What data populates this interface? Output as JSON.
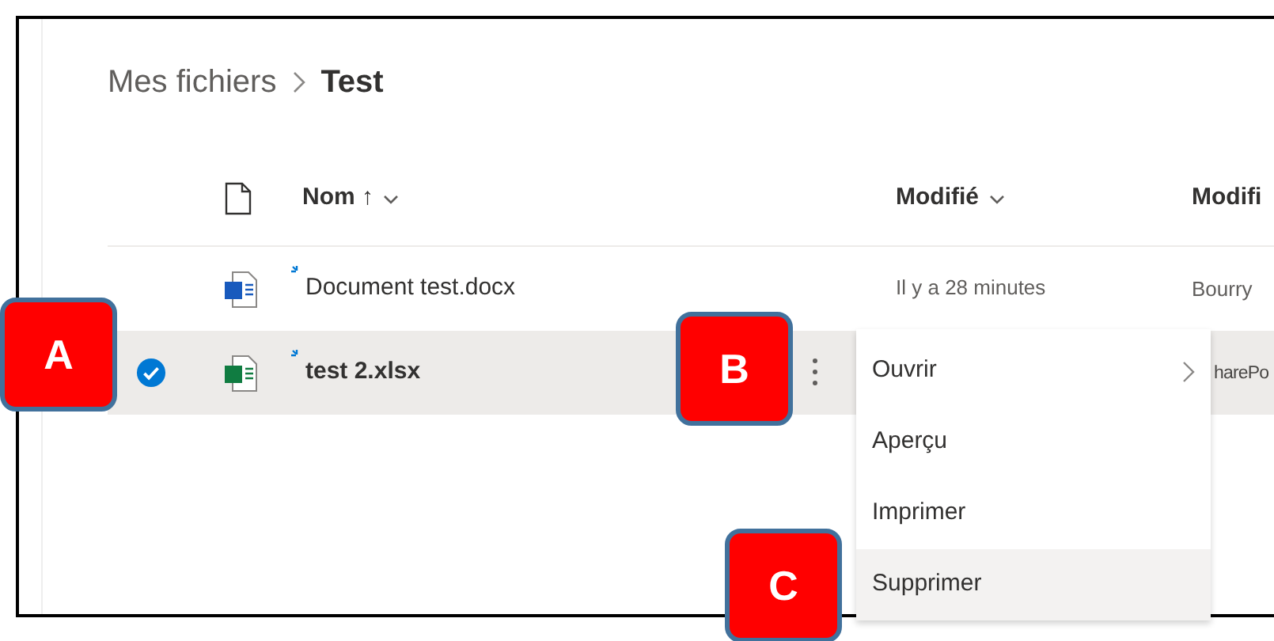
{
  "breadcrumb": [
    {
      "label": "Mes fichiers",
      "current": false
    },
    {
      "label": "Test",
      "current": true
    }
  ],
  "columns": [
    {
      "label": "Nom",
      "sort": "↑",
      "menu": true
    },
    {
      "label": "Modifié",
      "menu": true
    },
    {
      "label": "Modifi",
      "menu": false
    }
  ],
  "rows": [
    {
      "name": "Document test.docx",
      "kind": "word",
      "selected": false,
      "modified": "Il y a 28 minutes",
      "column_3": "Bourry"
    },
    {
      "name": "test 2.xlsx",
      "kind": "excel",
      "selected": true,
      "column_3": "harePo"
    }
  ],
  "context_menu": [
    {
      "label": "Ouvrir",
      "submenu": true,
      "highlighted": false
    },
    {
      "label": "Aperçu",
      "submenu": false,
      "highlighted": false
    },
    {
      "label": "Imprimer",
      "submenu": false,
      "highlighted": false
    },
    {
      "label": "Supprimer",
      "submenu": false,
      "highlighted": true
    }
  ],
  "callouts": [
    {
      "label": "A"
    },
    {
      "label": "B"
    },
    {
      "label": "C"
    }
  ]
}
